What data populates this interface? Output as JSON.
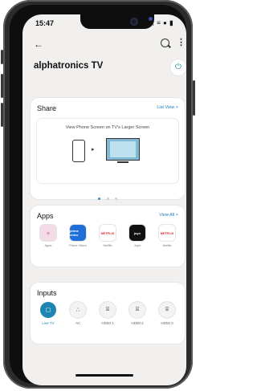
{
  "status": {
    "time": "15:47",
    "icons": "⋮≡ ● ▮"
  },
  "appbar": {
    "title": "alphatronics TV"
  },
  "share": {
    "heading": "Share",
    "link": "List View  >",
    "card_text": "View Phone Screen on TV's Larger Screen"
  },
  "apps": {
    "heading": "Apps",
    "link": "View All  >",
    "items": [
      {
        "name": "Apps",
        "icon_text": "☷",
        "color": "#f3dbe8",
        "fg": "#d05aa0"
      },
      {
        "name": "Prime Video",
        "icon_text": "prime video",
        "color": "#1e6fd8",
        "fg": "#ffffff"
      },
      {
        "name": "Netflix",
        "icon_text": "NETFLIX",
        "color": "#ffffff",
        "fg": "#d81f26"
      },
      {
        "name": "Joyn",
        "icon_text": "joyn",
        "color": "#111111",
        "fg": "#ffffff"
      },
      {
        "name": "Netflix",
        "icon_text": "NETFLIX",
        "color": "#ffffff",
        "fg": "#d81f26"
      }
    ]
  },
  "inputs": {
    "heading": "Inputs",
    "items": [
      {
        "name": "Live TV",
        "icon": "tv-icon",
        "glyph": "▢"
      },
      {
        "name": "AV",
        "icon": "av-icon",
        "glyph": "∴"
      },
      {
        "name": "HDMI 1",
        "icon": "hdmi-icon",
        "glyph": "⌸"
      },
      {
        "name": "HDMI 2",
        "icon": "hdmi-icon",
        "glyph": "⌸"
      },
      {
        "name": "HDMI 3",
        "icon": "hdmi-icon",
        "glyph": "⌸"
      }
    ]
  },
  "colors": {
    "accent": "#1d86b0",
    "link": "#2479b8",
    "background": "#f1f0ee"
  }
}
